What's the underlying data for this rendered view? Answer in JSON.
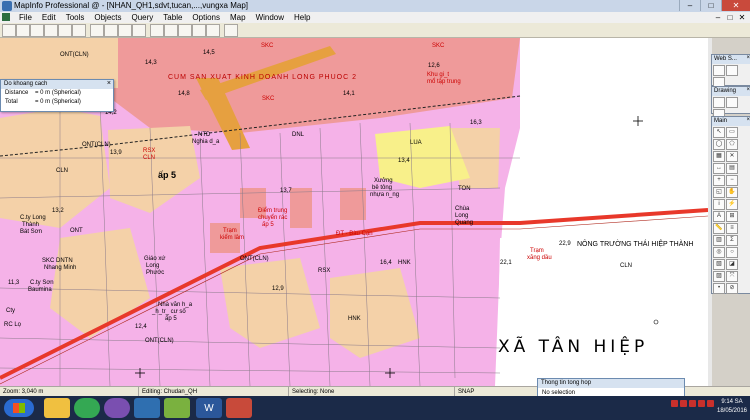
{
  "window": {
    "title": "MapInfo Professional @ - [NHAN_QH1,sdvt,tucan,...,vungxa Map]",
    "min": "–",
    "max": "□",
    "close": "✕"
  },
  "menu": [
    "File",
    "Edit",
    "Tools",
    "Objects",
    "Query",
    "Table",
    "Options",
    "Map",
    "Window",
    "Help"
  ],
  "measure_dialog": {
    "title": "Do khoang cach",
    "close": "×",
    "distance_label": "Distance",
    "distance_value": "= 0 m (Spherical)",
    "total_label": "Total",
    "total_value": "= 0 m (Spherical)"
  },
  "panels": {
    "web": "Web S...",
    "drawing": "Drawing",
    "main": "Main",
    "close": "×"
  },
  "map_labels": {
    "zone1": "CUM SAN XUAT KINH DOANH LONG PHUOC 2",
    "skc": "SKC",
    "cln": "CLN",
    "ont_cln": "ONT(CLN)",
    "ont": "ONT",
    "rsx": "RSX",
    "hnk": "HNK",
    "lua": "LUA",
    "ton": "TON",
    "dnl": "DNL",
    "ntd": "NTD",
    "nghiadia": "Nghia d_a",
    "ap5": "ấp 5",
    "khu_gt": "Khu gi_t",
    "mo_tap_trung": "mổ tập trung",
    "diem_trung": "Điểm trung",
    "chuyen_rac": "chuyển rác",
    "ap5b": "ấp 5",
    "tram_kiem": "Trạm",
    "kiem_lam": "kiểm lâm",
    "dt": "ĐT",
    "xuong": "Xưởng",
    "be_tong": "bê tông",
    "nhua_nong": "nhựa n_ng",
    "chua": "Chùa",
    "long_quang": "Long",
    "quang": "Quang",
    "tram_xang": "Trạm",
    "xang_dau": "xăng dầu",
    "road": "ĐT - Bàu Cạn",
    "farm_num": "22,9",
    "farm": "NÔNG TRƯỜNG THÁI HIỆP THÀNH",
    "ctly": "C.ty Long",
    "thanh": "Thành",
    "bat_son": "Bát Sơn",
    "skc_dntn": "SKC DNTN",
    "nhang_minh": "Nhang Minh",
    "cty_son": "C.ty Sơn",
    "baumina": "Baumina",
    "cty_rc": "Cty",
    "rc_lo": "RC Lọ",
    "giao_xu": "Giáo xứ",
    "long": "Long",
    "phuoc": "Phước",
    "nha_van_hoa": "Nhà văn h_a",
    "khu_pho": "_h_tr_ cư số",
    "ap5c": "ấp 5",
    "region": "XÃ TÂN HIỆP",
    "n14_5": "14,5",
    "n14_8": "14,8",
    "n14_1": "14,1",
    "n14_3": "14,3",
    "n14_2": "14,2",
    "n13_9": "13,9",
    "n13_2": "13,2",
    "n13_7": "13,7",
    "n13_4": "13,4",
    "n13": "13",
    "n12_6": "12,6",
    "n12_9": "12,9",
    "n12_4": "12,4",
    "n16_3": "16,3",
    "n16_4": "16,4",
    "n22_1": "22,1",
    "n11_3": "11,3"
  },
  "status": {
    "zoom": "Zoom: 3,040 m",
    "editing": "Editing: Chudan_QH",
    "selecting": "Selecting: None",
    "snap": "SNAP"
  },
  "popup": {
    "title": "Thong tin tong hop",
    "body": "No selection"
  },
  "clock": {
    "time": "9:14 SA",
    "date": "18/05/2016"
  },
  "colors": {
    "cln": "#f4d1a8",
    "ont": "#f5b2e8",
    "skc": "#ef9a9a",
    "lua": "#f8f08a",
    "road": "#e8382a",
    "zone_orange": "#e6a040"
  }
}
